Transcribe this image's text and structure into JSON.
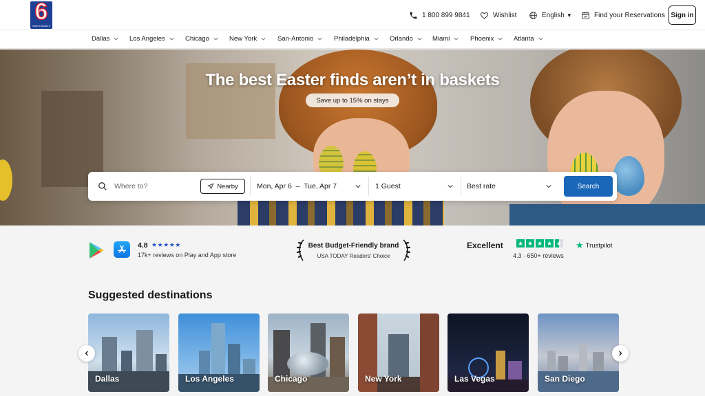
{
  "header": {
    "logo_text": "6",
    "logo_tagline": "Motel 6 Studio 6",
    "phone": "1 800 899 9841",
    "wishlist": "Wishlist",
    "language": "English",
    "reservations": "Find your Reservations",
    "signin": "Sign in"
  },
  "cities": [
    "Dallas",
    "Los Angeles",
    "Chicago",
    "New York",
    "San-Antonio",
    "Philadelphia",
    "Orlando",
    "Miami",
    "Phoenix",
    "Atlanta"
  ],
  "hero": {
    "title": "The best Easter finds aren’t in baskets",
    "pill": "Save up to 15% on stays"
  },
  "search": {
    "placeholder": "Where to?",
    "nearby": "Nearby",
    "dates": "Mon, Apr 6  –  Tue, Apr 7",
    "guests": "1 Guest",
    "rate": "Best rate",
    "button": "Search"
  },
  "trust": {
    "app_rating": "4.8",
    "app_stars": "★★★★★",
    "app_sub": "17k+ reviews on Play and App store",
    "brand_title": "Best Budget-Friendly brand",
    "brand_sub": "USA TODAY Readers' Choice",
    "tp_label": "Excellent",
    "tp_brand": "Trustpilot",
    "tp_sub": "4.3 · 650+ reviews"
  },
  "suggested": {
    "title": "Suggested destinations",
    "cards": [
      "Dallas",
      "Los Angeles",
      "Chicago",
      "New York",
      "Las Vegas",
      "San Diego"
    ]
  },
  "colors": {
    "brand_blue": "#1c3f94",
    "search_button": "#1a66b8",
    "trustpilot_green": "#00b67a"
  }
}
